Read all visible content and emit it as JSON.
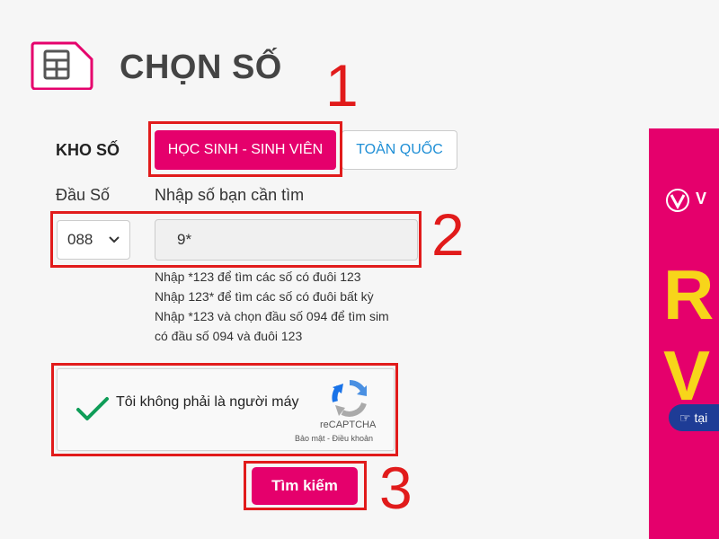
{
  "header": {
    "title": "CHỌN SỐ"
  },
  "steps": [
    "1",
    "2",
    "3"
  ],
  "kho_so": {
    "label": "KHO SỐ",
    "tabs": [
      {
        "label": "HỌC SINH - SINH VIÊN",
        "active": true
      },
      {
        "label": "TOÀN QUỐC",
        "active": false
      }
    ]
  },
  "form": {
    "prefix_label": "Đầu Số",
    "prefix_value": "088",
    "search_label": "Nhập số bạn cần tìm",
    "search_value": "9*",
    "hints": [
      "Nhập *123 để tìm các số có đuôi 123",
      "Nhập 123* để tìm các số có đuôi bất kỳ",
      "Nhập *123 và chọn đầu số 094 để tìm sim",
      "có đầu số 094 và đuôi 123"
    ]
  },
  "captcha": {
    "text": "Tôi không phải là người máy",
    "brand": "reCAPTCHA",
    "links": "Bảo mật - Điều khoản",
    "checked": true
  },
  "search_button": {
    "label": "Tìm kiếm"
  },
  "banner": {
    "logo_text": "V",
    "big_letter_1": "R",
    "big_letter_2": "V",
    "pill_text": "tại"
  },
  "colors": {
    "accent": "#e5006c",
    "highlight": "#e11b1b",
    "link": "#1f8fd6",
    "banner_yellow": "#f7d51a"
  }
}
